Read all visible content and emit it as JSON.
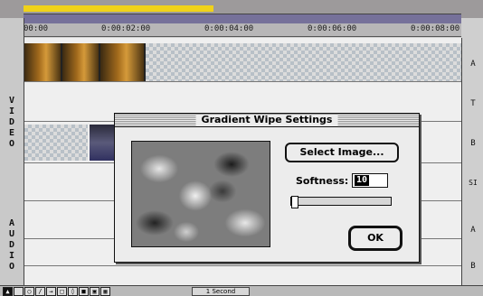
{
  "timeline": {
    "ruler_labels": [
      "00:00",
      "0:00:02:00",
      "0:00:04:00",
      "0:00:06:00",
      "0:00:08:00"
    ]
  },
  "tracks": {
    "video_label": [
      "V",
      "I",
      "D",
      "E",
      "O"
    ],
    "audio_label": [
      "A",
      "U",
      "D",
      "I",
      "O"
    ],
    "right_labels": [
      "A",
      "T",
      "B",
      "SI",
      "A",
      "B"
    ]
  },
  "bottom_bar": {
    "scale_label": "1 Second"
  },
  "dialog": {
    "title": "Gradient Wipe Settings",
    "select_button": "Select Image...",
    "softness_label": "Softness:",
    "softness_value": "10",
    "softness_slider_level": 0.0,
    "ok_button": "OK"
  },
  "colors": {
    "work_area_bar": "#f0d21a",
    "slider_strip": "#76719a"
  }
}
